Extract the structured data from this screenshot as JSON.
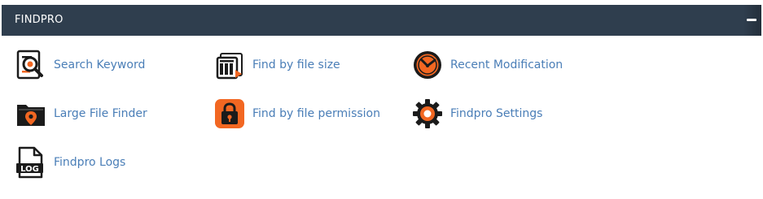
{
  "panel": {
    "title": "FINDPRO",
    "collapse_icon": "minus-icon"
  },
  "items": [
    {
      "label": "Search Keyword",
      "icon": "search-keyword-icon"
    },
    {
      "label": "Find by file size",
      "icon": "file-size-icon"
    },
    {
      "label": "Recent Modification",
      "icon": "clock-icon"
    },
    {
      "label": "Large File Finder",
      "icon": "folder-location-icon"
    },
    {
      "label": "Find by file permission",
      "icon": "lock-icon"
    },
    {
      "label": "Findpro Settings",
      "icon": "gear-icon"
    },
    {
      "label": "Findpro Logs",
      "icon": "log-file-icon"
    }
  ],
  "colors": {
    "header_bg": "#2f3e4e",
    "link": "#4a7eb7",
    "accent_orange": "#f26722"
  }
}
